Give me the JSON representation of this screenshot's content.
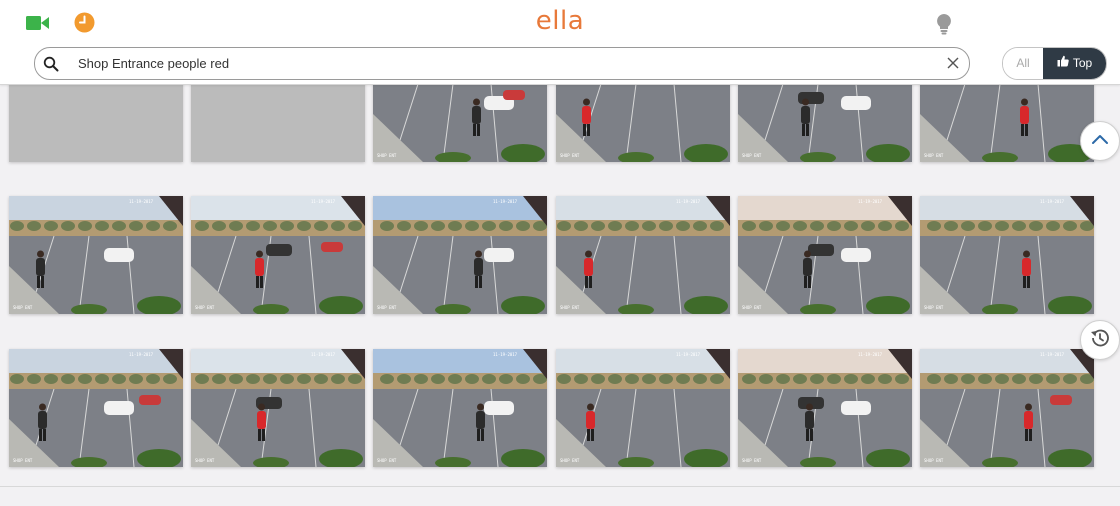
{
  "app": {
    "logo": "ella"
  },
  "search": {
    "query": "Shop Entrance people red"
  },
  "filter": {
    "all_label": "All",
    "top_label": "Top",
    "selected": "Top"
  },
  "icons": {
    "camera": "video-camera-icon",
    "history": "clock-icon",
    "tips": "lightbulb-icon",
    "search": "search-icon",
    "clear": "close-icon",
    "top": "thumbs-up-icon",
    "scroll_top": "chevron-up-icon",
    "recent": "history-icon"
  },
  "colors": {
    "brand": "#e8793a",
    "camera": "#3cb34a",
    "dark_toggle": "#2f3a45"
  },
  "results": [
    {
      "row": 1,
      "col": 1,
      "state": "loading"
    },
    {
      "row": 1,
      "col": 2,
      "state": "loading"
    },
    {
      "row": 1,
      "col": 3,
      "state": "image"
    },
    {
      "row": 1,
      "col": 4,
      "state": "image"
    },
    {
      "row": 1,
      "col": 5,
      "state": "image"
    },
    {
      "row": 1,
      "col": 6,
      "state": "image"
    },
    {
      "row": 2,
      "col": 1,
      "state": "image"
    },
    {
      "row": 2,
      "col": 2,
      "state": "image"
    },
    {
      "row": 2,
      "col": 3,
      "state": "image"
    },
    {
      "row": 2,
      "col": 4,
      "state": "image"
    },
    {
      "row": 2,
      "col": 5,
      "state": "image"
    },
    {
      "row": 2,
      "col": 6,
      "state": "image"
    },
    {
      "row": 3,
      "col": 1,
      "state": "image"
    },
    {
      "row": 3,
      "col": 2,
      "state": "image"
    },
    {
      "row": 3,
      "col": 3,
      "state": "image"
    },
    {
      "row": 3,
      "col": 4,
      "state": "image"
    },
    {
      "row": 3,
      "col": 5,
      "state": "image"
    },
    {
      "row": 3,
      "col": 6,
      "state": "image"
    }
  ]
}
